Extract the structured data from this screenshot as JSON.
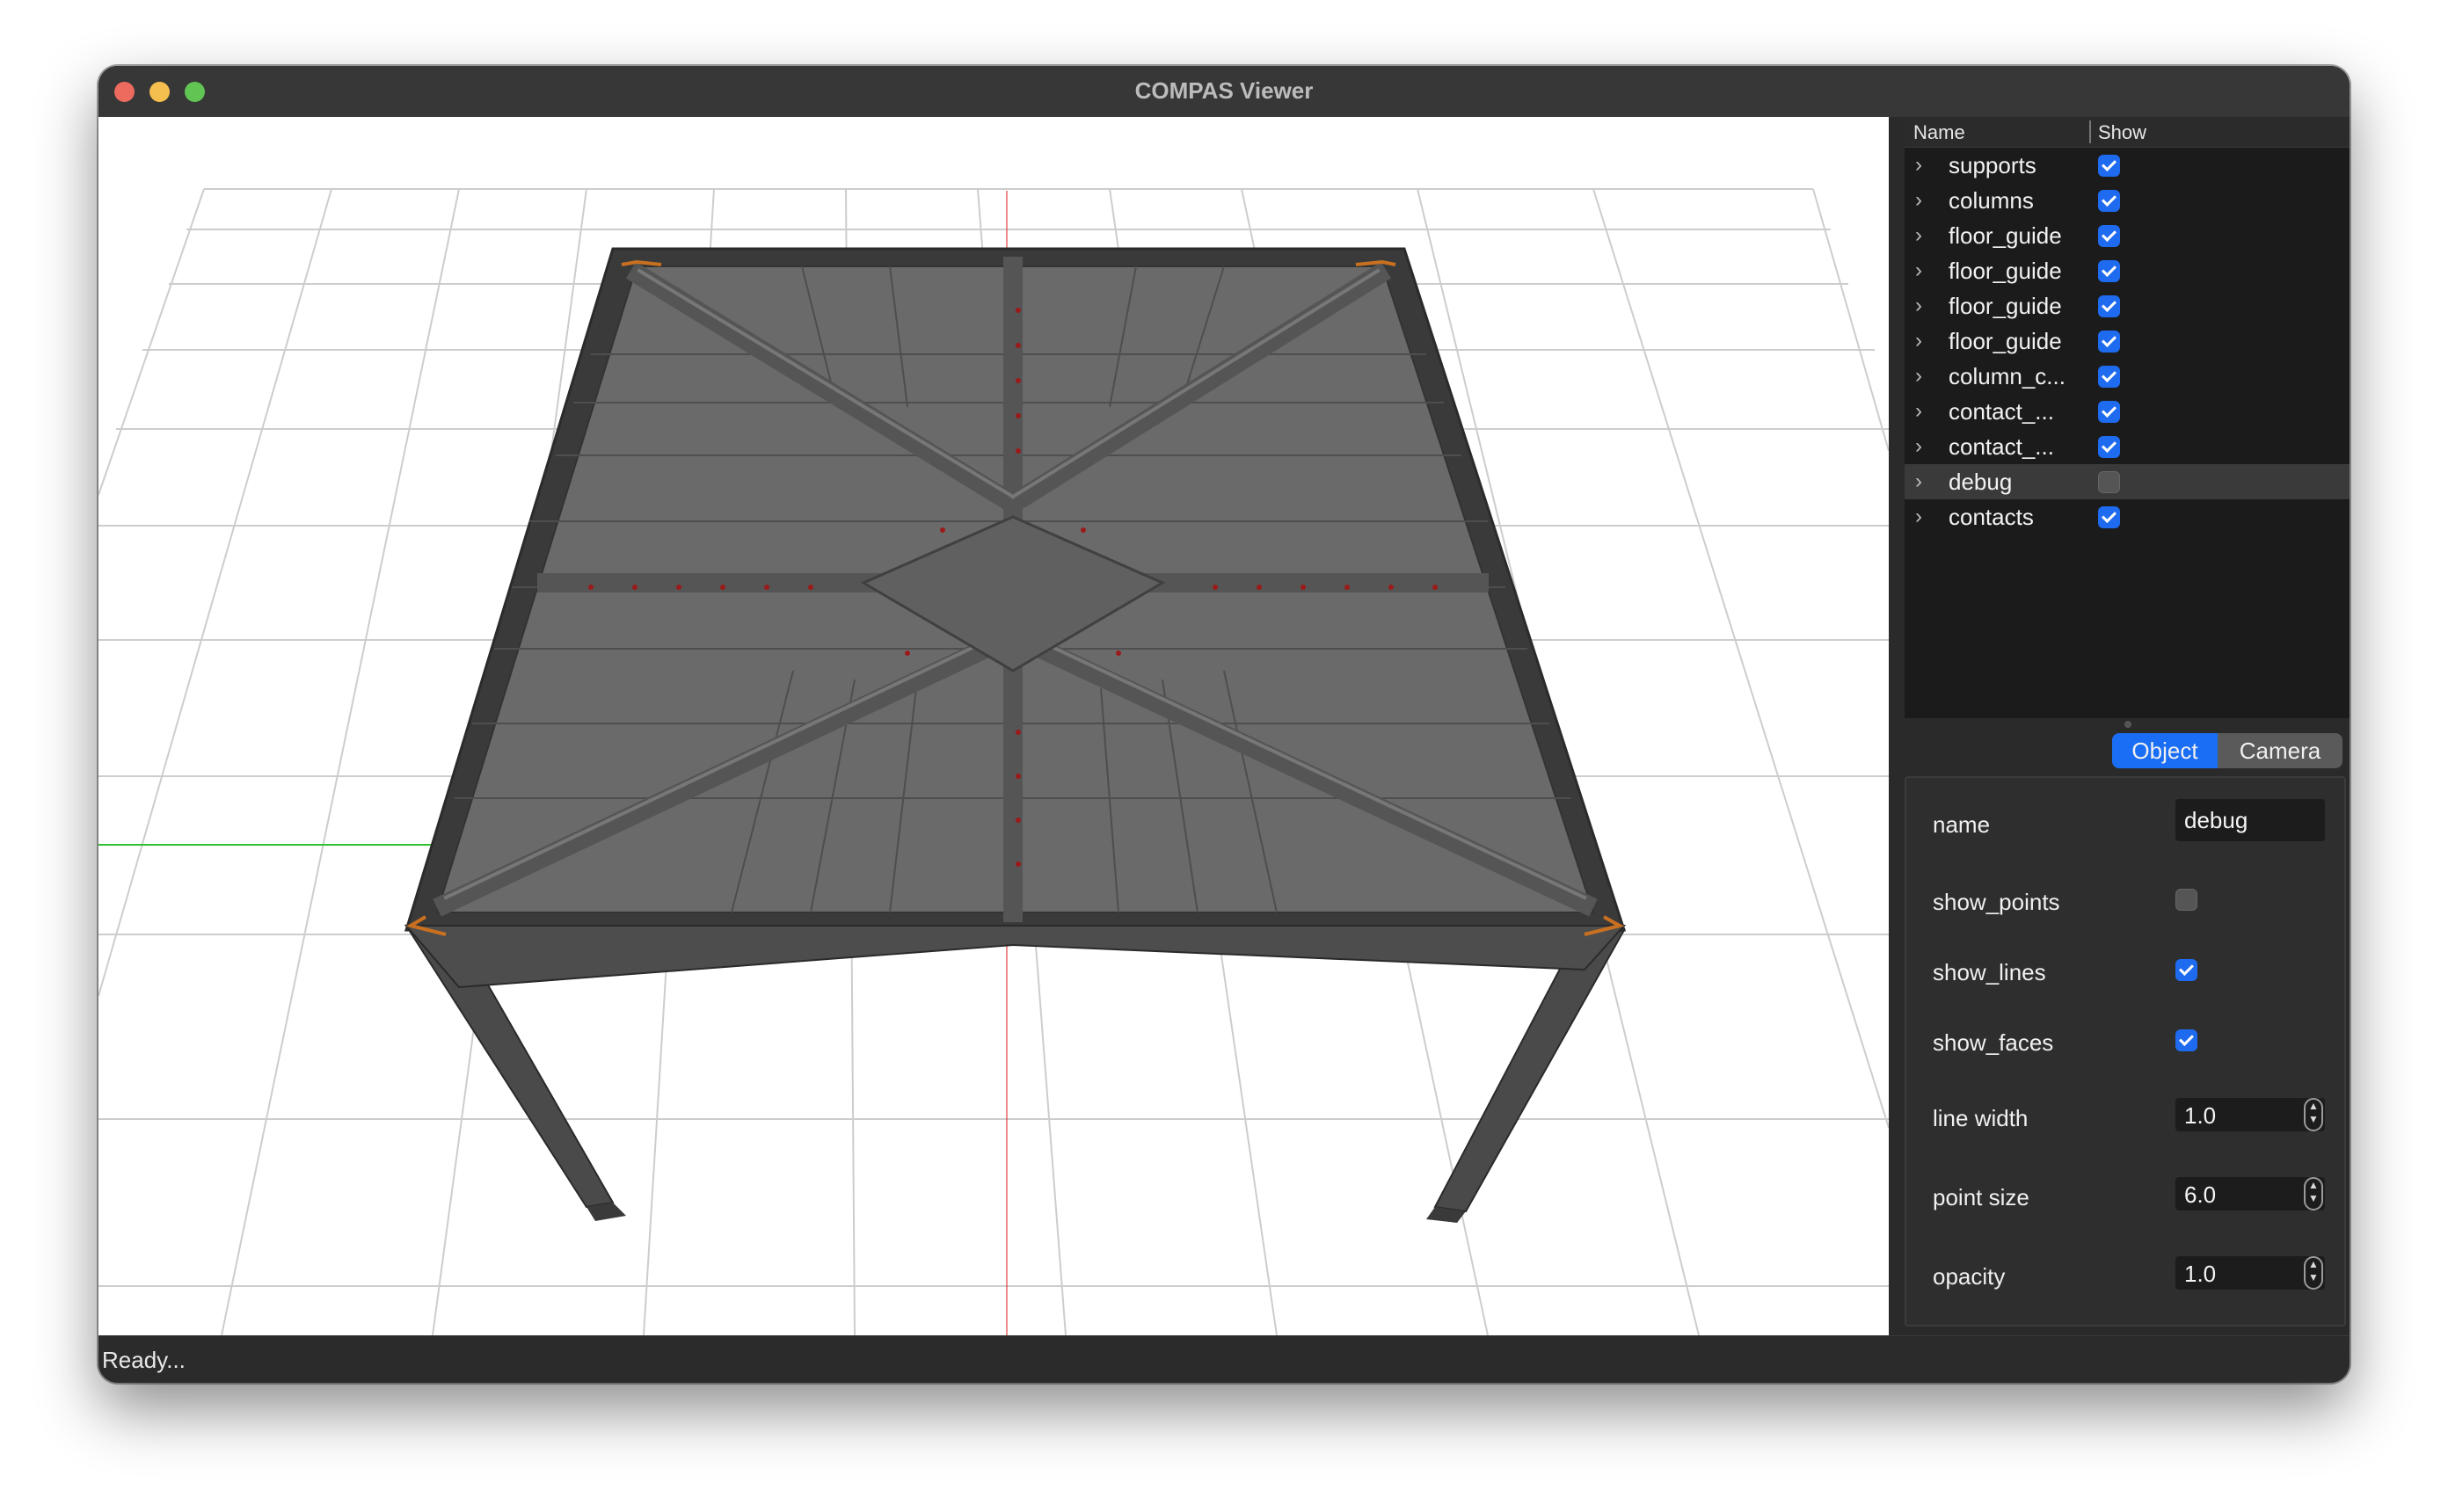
{
  "window": {
    "title": "COMPAS Viewer",
    "status": "Ready..."
  },
  "scene_tree": {
    "header_name": "Name",
    "header_show": "Show",
    "items": [
      {
        "label": "supports",
        "visible": true
      },
      {
        "label": "columns",
        "visible": true
      },
      {
        "label": "floor_guide",
        "visible": true
      },
      {
        "label": "floor_guide",
        "visible": true
      },
      {
        "label": "floor_guide",
        "visible": true
      },
      {
        "label": "floor_guide",
        "visible": true
      },
      {
        "label": "column_c...",
        "visible": true
      },
      {
        "label": "contact_...",
        "visible": true
      },
      {
        "label": "contact_...",
        "visible": true
      },
      {
        "label": "debug",
        "visible": false,
        "selected": true
      },
      {
        "label": "contacts",
        "visible": true
      }
    ]
  },
  "tabs": {
    "object": "Object",
    "camera": "Camera",
    "active": "Object"
  },
  "properties": {
    "name_label": "name",
    "name_value": "debug",
    "show_points_label": "show_points",
    "show_points": false,
    "show_lines_label": "show_lines",
    "show_lines": true,
    "show_faces_label": "show_faces",
    "show_faces": true,
    "line_width_label": "line width",
    "line_width": "1.0",
    "point_size_label": "point size",
    "point_size": "6.0",
    "opacity_label": "opacity",
    "opacity": "1.0"
  },
  "icons": {
    "expand": "chevron-right-icon",
    "spin": "stepper-arrows-icon"
  },
  "colors": {
    "accent": "#1e6bf0",
    "model_gray": "#5c5c5c",
    "x_axis": "#e03030",
    "y_axis": "#30c030",
    "grid": "#c8c8c8"
  }
}
